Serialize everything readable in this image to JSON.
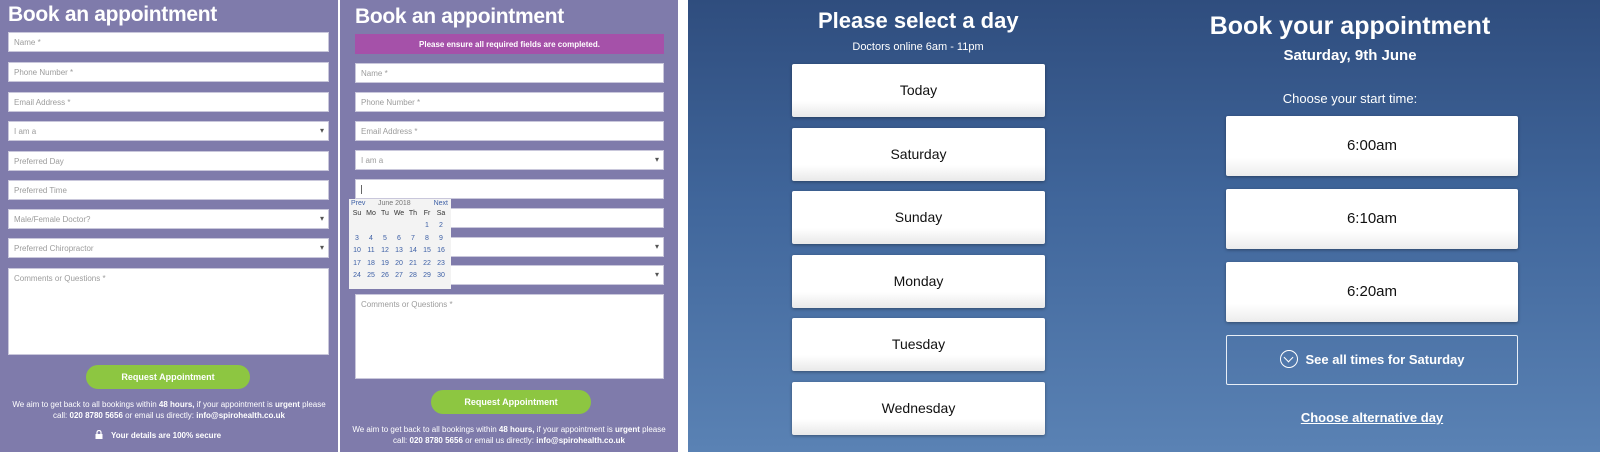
{
  "form_a": {
    "title": "Book an appointment",
    "fields": {
      "name": "Name *",
      "phone": "Phone Number *",
      "email": "Email Address *",
      "i_am_a": "I am a",
      "preferred_day": "Preferred Day",
      "preferred_time": "Preferred Time",
      "doctor_gender": "Male/Female Doctor?",
      "chiropractor": "Preferred Chiropractor",
      "comments": "Comments or Questions *"
    },
    "submit_label": "Request Appointment",
    "info_prefix": "We aim to get back to all bookings within ",
    "info_hours": "48 hours,",
    "info_mid": " if your appointment is ",
    "info_urgent": "urgent",
    "info_suffix": " please call: ",
    "phone_number": "020 8780 5656",
    "info_or": " or email us directly: ",
    "email_address": "info@spirohealth.co.uk",
    "secure_text": "Your details are 100% secure"
  },
  "form_b": {
    "title": "Book an appointment",
    "notice": "Please ensure all required fields are completed.",
    "fields": {
      "name": "Name *",
      "phone": "Phone Number *",
      "email": "Email Address *",
      "i_am_a": "I am a",
      "comments": "Comments or Questions *"
    },
    "calendar": {
      "prev": "Prev",
      "month": "June 2018",
      "next": "Next",
      "dow": [
        "Su",
        "Mo",
        "Tu",
        "We",
        "Th",
        "Fr",
        "Sa"
      ],
      "weeks": [
        [
          "",
          "",
          "",
          "",
          "",
          "1",
          "2"
        ],
        [
          "3",
          "4",
          "5",
          "6",
          "7",
          "8",
          "9"
        ],
        [
          "10",
          "11",
          "12",
          "13",
          "14",
          "15",
          "16"
        ],
        [
          "17",
          "18",
          "19",
          "20",
          "21",
          "22",
          "23"
        ],
        [
          "24",
          "25",
          "26",
          "27",
          "28",
          "29",
          "30"
        ]
      ]
    },
    "submit_label": "Request Appointment",
    "info_prefix": "We aim to get back to all bookings within ",
    "info_hours": "48 hours,",
    "info_mid": " if your appointment is ",
    "info_urgent": "urgent",
    "info_suffix": " please call: ",
    "phone_number": "020 8780 5656",
    "info_or": " or email us directly: ",
    "email_address": "info@spirohealth.co.uk"
  },
  "day_select": {
    "title": "Please select a day",
    "subtitle": "Doctors online 6am - 11pm",
    "days": [
      "Today",
      "Saturday",
      "Sunday",
      "Monday",
      "Tuesday",
      "Wednesday"
    ]
  },
  "time_select": {
    "title": "Book your appointment",
    "date": "Saturday, 9th June",
    "prompt": "Choose your start time:",
    "times": [
      "6:00am",
      "6:10am",
      "6:20am"
    ],
    "see_all": "See all times for Saturday",
    "alternative": "Choose alternative day"
  },
  "colors": {
    "form_bg": "#7f7bab",
    "notice_bg": "#a551a9",
    "submit_bg": "#8dc641",
    "blue_top": "#2f4d7e",
    "blue_bottom": "#5a82b4"
  }
}
